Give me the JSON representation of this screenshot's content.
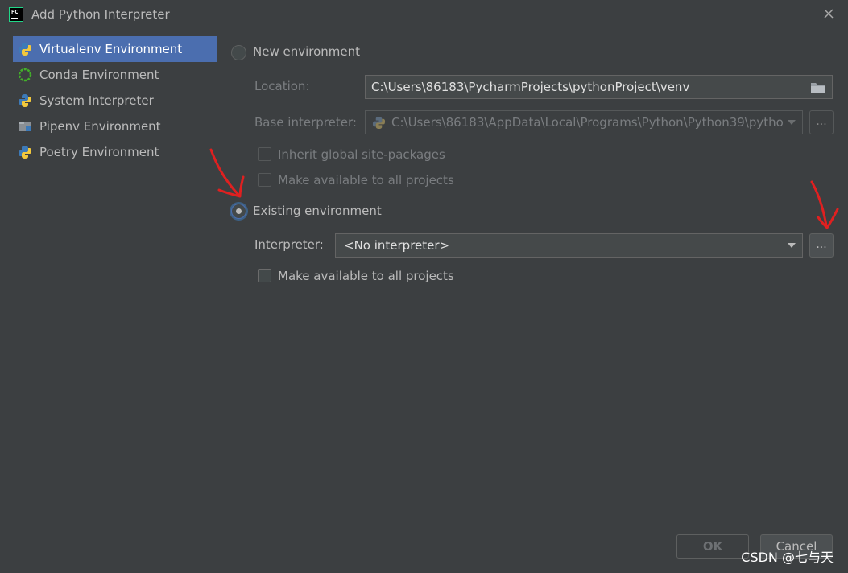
{
  "window": {
    "title": "Add Python Interpreter"
  },
  "sidebar": {
    "items": [
      {
        "label": "Virtualenv Environment",
        "icon": "python-venv-icon"
      },
      {
        "label": "Conda Environment",
        "icon": "conda-icon"
      },
      {
        "label": "System Interpreter",
        "icon": "python-icon"
      },
      {
        "label": "Pipenv Environment",
        "icon": "pipenv-icon"
      },
      {
        "label": "Poetry Environment",
        "icon": "poetry-icon"
      }
    ]
  },
  "new_env": {
    "radio_label": "New environment",
    "location_label": "Location:",
    "location_value": "C:\\Users\\86183\\PycharmProjects\\pythonProject\\venv",
    "base_interpreter_label": "Base interpreter:",
    "base_interpreter_value": "C:\\Users\\86183\\AppData\\Local\\Programs\\Python\\Python39\\pytho",
    "inherit_label": "Inherit global site-packages",
    "make_available_label": "Make available to all projects"
  },
  "existing_env": {
    "radio_label": "Existing environment",
    "interpreter_label": "Interpreter:",
    "interpreter_value": "<No interpreter>",
    "browse_label": "...",
    "make_available_label": "Make available to all projects"
  },
  "browse_label": "...",
  "footer": {
    "ok_label": "OK",
    "cancel_label": "Cancel"
  },
  "watermark": "CSDN @七与天",
  "colors": {
    "background": "#3c3f41",
    "selection": "#4b6eaf",
    "annotation": "#e02020"
  }
}
